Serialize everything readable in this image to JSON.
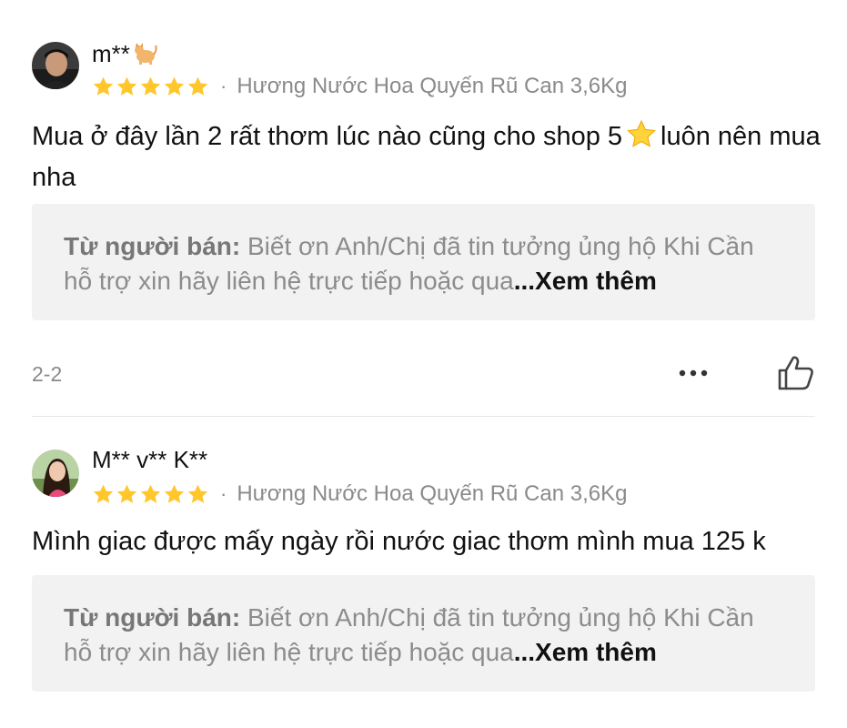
{
  "reviews": [
    {
      "username": "m**",
      "username_icon": "cat-emoji-icon",
      "rating": 5,
      "variant": "Hương Nước Hoa Quyến Rũ Can 3,6Kg",
      "text_before_emoji": "Mua ở đây lần 2 rất thơm lúc nào cũng cho shop 5",
      "text_emoji": "star-emoji-icon",
      "text_after_emoji": "luôn nên mua nha",
      "seller_label": "Từ người bán:",
      "seller_reply": "Biết ơn Anh/Chị đã tin tưởng ủng hộ Khi Cần hỗ trợ xin hãy liên hệ trực tiếp hoặc qua",
      "see_more": "...Xem thêm",
      "date": "2-2"
    },
    {
      "username": "M** v** K**",
      "rating": 5,
      "variant": "Hương Nước Hoa Quyến Rũ Can 3,6Kg",
      "text": "Mình giac được mấy ngày rồi nước giac thơm mình mua 125 k",
      "seller_label": "Từ người bán:",
      "seller_reply": "Biết ơn Anh/Chị đã tin tưởng ủng hộ Khi Cần hỗ trợ xin hãy liên hệ trực tiếp hoặc qua",
      "see_more": "...Xem thêm"
    }
  ],
  "separator": "·",
  "colors": {
    "star": "#FFC72C",
    "muted_text": "#8A8A8A",
    "reply_bg": "#F2F2F2"
  }
}
